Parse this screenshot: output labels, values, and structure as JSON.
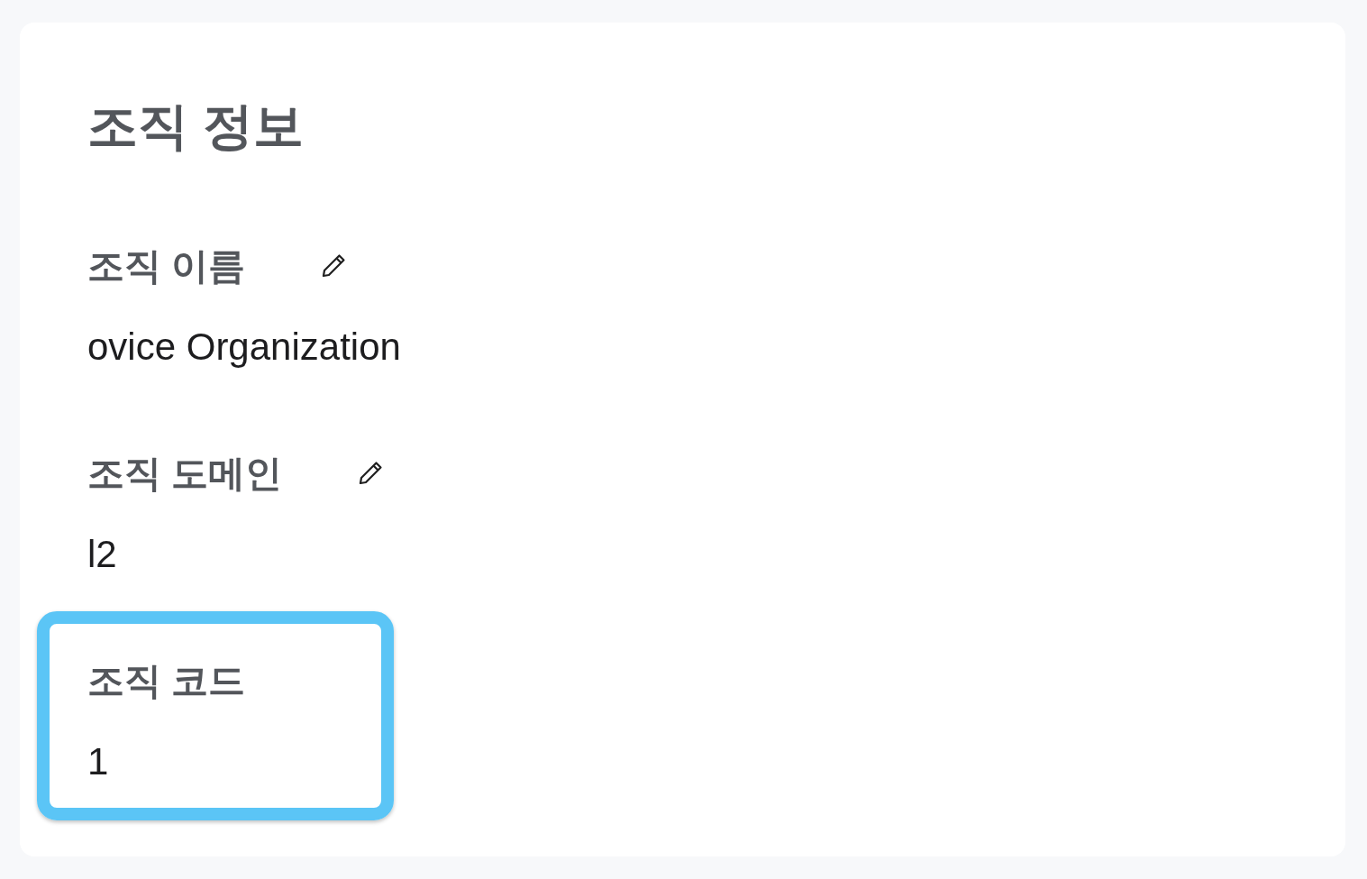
{
  "title": "조직 정보",
  "fields": [
    {
      "label": "조직 이름",
      "value": "ovice Organization",
      "editable": true,
      "highlighted": false
    },
    {
      "label": "조직 도메인",
      "value": "l2",
      "editable": true,
      "highlighted": false
    },
    {
      "label": "조직 코드",
      "value": "1",
      "editable": false,
      "highlighted": true
    }
  ]
}
